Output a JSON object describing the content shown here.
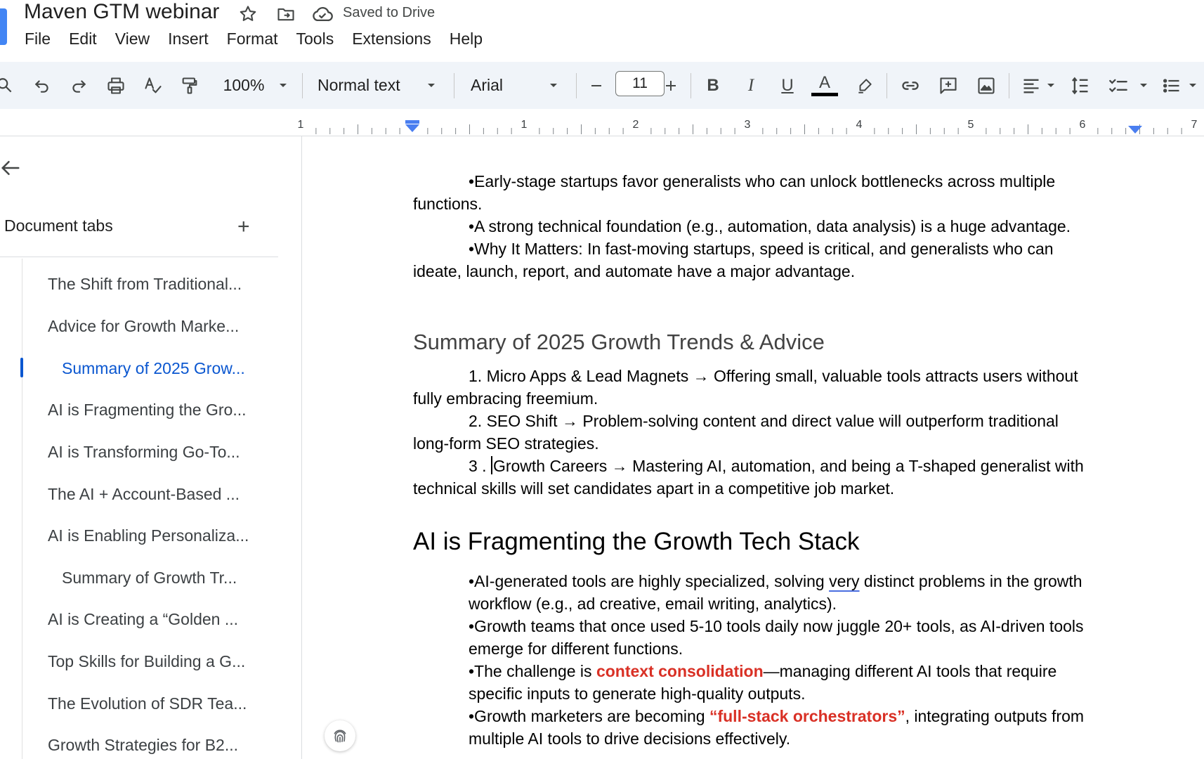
{
  "app": {
    "doc_title": "Maven GTM webinar",
    "save_status": "Saved to Drive"
  },
  "menu": [
    "File",
    "Edit",
    "View",
    "Insert",
    "Format",
    "Tools",
    "Extensions",
    "Help"
  ],
  "toolbar": {
    "zoom": "100%",
    "style": "Normal text",
    "font": "Arial",
    "font_size": "11",
    "bold": "B",
    "italic": "I",
    "underline": "U",
    "text_color": "A"
  },
  "ruler": {
    "labels": [
      "1",
      "1",
      "2",
      "3",
      "4",
      "5",
      "6",
      "7"
    ]
  },
  "sidebar": {
    "heading": "Document tabs",
    "add": "+",
    "tabs": [
      {
        "label": "The Shift from Traditional...",
        "indent": 0,
        "active": false
      },
      {
        "label": "Advice for Growth Marke...",
        "indent": 0,
        "active": false
      },
      {
        "label": "Summary of 2025 Grow...",
        "indent": 1,
        "active": true
      },
      {
        "label": "AI is Fragmenting the Gro...",
        "indent": 0,
        "active": false
      },
      {
        "label": "AI is Transforming Go-To...",
        "indent": 0,
        "active": false
      },
      {
        "label": "The AI + Account-Based ...",
        "indent": 0,
        "active": false
      },
      {
        "label": "AI is Enabling Personaliza...",
        "indent": 0,
        "active": false
      },
      {
        "label": "Summary of Growth Tr...",
        "indent": 1,
        "active": false
      },
      {
        "label": "AI is Creating a “Golden ...",
        "indent": 0,
        "active": false
      },
      {
        "label": "Top Skills for Building a G...",
        "indent": 0,
        "active": false
      },
      {
        "label": "The Evolution of SDR Tea...",
        "indent": 0,
        "active": false
      },
      {
        "label": "Growth Strategies for B2...",
        "indent": 0,
        "active": false
      }
    ]
  },
  "document": {
    "intro_bullets": {
      "b1_l1": "•Early-stage startups favor generalists who can unlock bottlenecks across multiple",
      "b1_l2": "functions.",
      "b2": "•A strong technical foundation (e.g., automation, data analysis) is a huge advantage.",
      "b3_l1": "•Why It Matters: In fast-moving startups, speed is critical, and generalists who can",
      "b3_l2": "ideate, launch, report, and automate have a major advantage."
    },
    "summary_heading": "Summary of 2025 Growth Trends & Advice",
    "summary_items": {
      "i1_l1": "1. Micro Apps & Lead Magnets → Offering small, valuable tools attracts users without",
      "i1_l2": "fully embracing freemium.",
      "i2_l1": "2. SEO Shift → Problem-solving content and direct value will outperform traditional",
      "i2_l2": "long-form SEO strategies.",
      "i3_prefix": "3 . ",
      "i3_l1": "Growth Careers → Mastering AI, automation, and being a T-shaped generalist with",
      "i3_l2": "technical skills will set candidates apart in a competitive job market."
    },
    "fragment_heading": "AI is Fragmenting the Growth Tech Stack",
    "fragment_bullets": {
      "f1_a": "•AI-generated tools are highly specialized, solving ",
      "f1_squig": "very",
      "f1_b": " distinct problems in the growth",
      "f1_l2": "workflow (e.g., ad creative, email writing, analytics).",
      "f2_l1": "•Growth teams that once used 5-10 tools daily now juggle 20+ tools, as AI-driven tools",
      "f2_l2": "emerge for different functions.",
      "f3_a": "•The challenge is ",
      "f3_red": "context consolidation",
      "f3_b": "—managing different AI tools that require",
      "f3_l2": "specific inputs to generate high-quality outputs.",
      "f4_a": "•Growth marketers are becoming ",
      "f4_red": "“full-stack orchestrators”",
      "f4_b": ", integrating outputs from",
      "f4_l2": "multiple AI tools to drive decisions effectively."
    }
  },
  "colors": {
    "accent": "#0b57d0",
    "highlight_red": "#d93025",
    "toolbar_bg": "#f0f4f9",
    "spell_underline": "#4a6ee0"
  }
}
